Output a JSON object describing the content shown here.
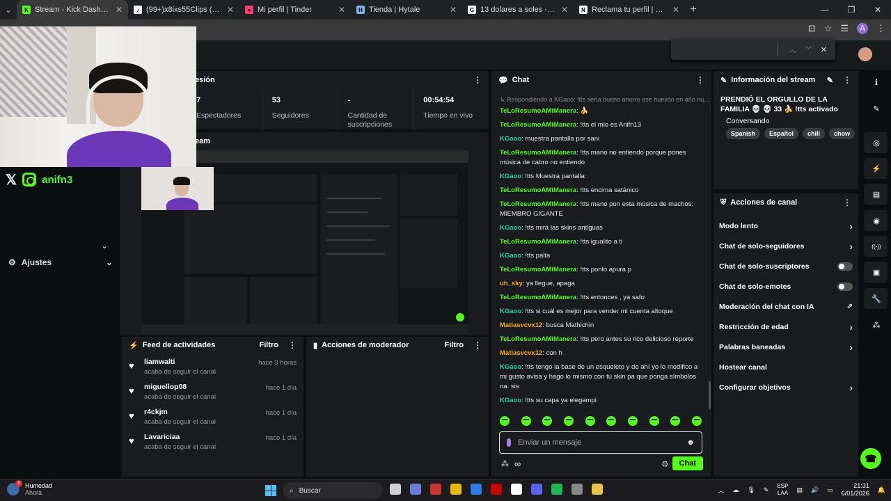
{
  "browser": {
    "tabs": [
      {
        "title": "Stream - Kick Dashboard",
        "fav_color": "#53fc18",
        "fav_letter": "K",
        "active": true
      },
      {
        "title": "(99+)x8ixs55Clips (@xbixs55clip",
        "fav_color": "#ffffff",
        "fav_letter": "♪"
      },
      {
        "title": "Mi perfil | Tinder",
        "fav_color": "#fe3c72",
        "fav_letter": "●"
      },
      {
        "title": "Tienda | Hytale",
        "fav_color": "#7fb2e5",
        "fav_letter": "H"
      },
      {
        "title": "13 dolares a soles - Buscar con",
        "fav_color": "#ffffff",
        "fav_letter": "G"
      },
      {
        "title": "Reclama tu perfil | NameMC",
        "fav_color": "#ffffff",
        "fav_letter": "N"
      }
    ],
    "new_tab": "+",
    "profile_letter": "A"
  },
  "social": {
    "handle": "anifn3"
  },
  "nav": {
    "ajustes": "Ajustes"
  },
  "session": {
    "title": "esión",
    "stats": [
      {
        "value": "7",
        "label": "Espectadores"
      },
      {
        "value": "53",
        "label": "Seguidores"
      },
      {
        "value": "-",
        "label": "Cantidad de suscripciones"
      },
      {
        "value": "00:54:54",
        "label": "Tiempo en vivo"
      }
    ]
  },
  "stream_preview": {
    "title": "eam"
  },
  "activity_feed": {
    "title": "Feed de actividades",
    "filter": "Filtro",
    "items": [
      {
        "name": "liamwalti",
        "sub": "acaba de seguir el canal",
        "time": "hace 3 horas"
      },
      {
        "name": "miguellop08",
        "sub": "acaba de seguir el canal",
        "time": "hace 1 día"
      },
      {
        "name": "r4ckjm",
        "sub": "acaba de seguir el canal",
        "time": "hace 1 día"
      },
      {
        "name": "Lavariciaa",
        "sub": "acaba de seguir el canal",
        "time": "hace 1 día"
      }
    ]
  },
  "mod_actions": {
    "title": "Acciones de moderador",
    "filter": "Filtro"
  },
  "chat": {
    "title": "Chat",
    "reply_to": "Respondiendo a KGaoo: !tts sería bueno ahorro ese huevón en año nu...",
    "messages": [
      {
        "user": "TeLoResumoAMiManera",
        "color": "#53fc18",
        "text": "🍌"
      },
      {
        "user": "TeLoResumoAMiManera",
        "color": "#53fc18",
        "text": "!tts el mio es Anifn13"
      },
      {
        "user": "KGaoo",
        "color": "#1fd6a0",
        "text": "muestra pantalla por sani"
      },
      {
        "user": "TeLoResumoAMiManera",
        "color": "#53fc18",
        "text": "!tts mano no entiendo porque pones música de cabro no entiendo"
      },
      {
        "user": "KGaoo",
        "color": "#1fd6a0",
        "text": "!tts Muestra pantalla"
      },
      {
        "user": "TeLoResumoAMiManera",
        "color": "#53fc18",
        "text": "!tts encima satánico"
      },
      {
        "user": "TeLoResumoAMiManera",
        "color": "#53fc18",
        "text": "!tts mano pon esta música de machos: MIEMBRO GIGANTE"
      },
      {
        "user": "KGaoo",
        "color": "#1fd6a0",
        "text": "!tts mira las skins antiguas"
      },
      {
        "user": "TeLoResumoAMiManera",
        "color": "#53fc18",
        "text": "!tts igualito a ti"
      },
      {
        "user": "KGaoo",
        "color": "#1fd6a0",
        "text": "!tts palta"
      },
      {
        "user": "TeLoResumoAMiManera",
        "color": "#53fc18",
        "text": "!tts ponlo apura p"
      },
      {
        "user": "uh_sky",
        "color": "#f5a623",
        "text": "ya llegue, apaga"
      },
      {
        "user": "TeLoResumoAMiManera",
        "color": "#53fc18",
        "text": "!tts entonces , ya safo"
      },
      {
        "user": "KGaoo",
        "color": "#1fd6a0",
        "text": "!tts si cuál es mejor para vender mi cuenta altoque"
      },
      {
        "user": "Matiasvcvx12",
        "color": "#f5a623",
        "text": "busca Mathichin"
      },
      {
        "user": "TeLoResumoAMiManera",
        "color": "#53fc18",
        "text": "!tts pero antes su rico delicioso reporte"
      },
      {
        "user": "Matiasvcvx12",
        "color": "#f5a623",
        "text": "con h"
      },
      {
        "user": "KGaoo",
        "color": "#1fd6a0",
        "text": "!tts tengo la base de un esqueleto y de ahí yo lo modifico a mi gusto avisa y hago lo mismo con tu skin pa que ponga símbolos na. sis"
      },
      {
        "user": "KGaoo",
        "color": "#1fd6a0",
        "text": "!tts su capa ya elegampi"
      }
    ],
    "input_placeholder": "Enviar un mensaje",
    "send_label": "Chat",
    "infinity": "∞"
  },
  "stream_info": {
    "title": "Información del stream",
    "stream_title": "PRENDIÓ EL ORGULLO DE LA FAMILIA 💀 💀 33 🍌 !tts activado",
    "category": "Conversando",
    "tags": [
      "Spanish",
      "Español",
      "chill",
      "chow"
    ]
  },
  "channel_actions": {
    "title": "Acciones de canal",
    "items": [
      {
        "label": "Modo lento",
        "control": "arrow"
      },
      {
        "label": "Chat de solo-seguidores",
        "control": "arrow"
      },
      {
        "label": "Chat de solo-suscriptores",
        "control": "toggle"
      },
      {
        "label": "Chat de solo-emotes",
        "control": "toggle"
      },
      {
        "label": "Moderación del chat con IA",
        "control": "external"
      },
      {
        "label": "Restricción de edad",
        "control": "arrow"
      },
      {
        "label": "Palabras baneadas",
        "control": "arrow"
      },
      {
        "label": "Hostear canal",
        "control": "none"
      },
      {
        "label": "Configurar objetivos",
        "control": "arrow"
      }
    ]
  },
  "taskbar": {
    "weather_title": "Humedad",
    "weather_sub": "Ahora",
    "search": "Buscar",
    "lang1": "ESP",
    "lang2": "LAA",
    "time": "21:31",
    "date": "6/01/2026"
  }
}
